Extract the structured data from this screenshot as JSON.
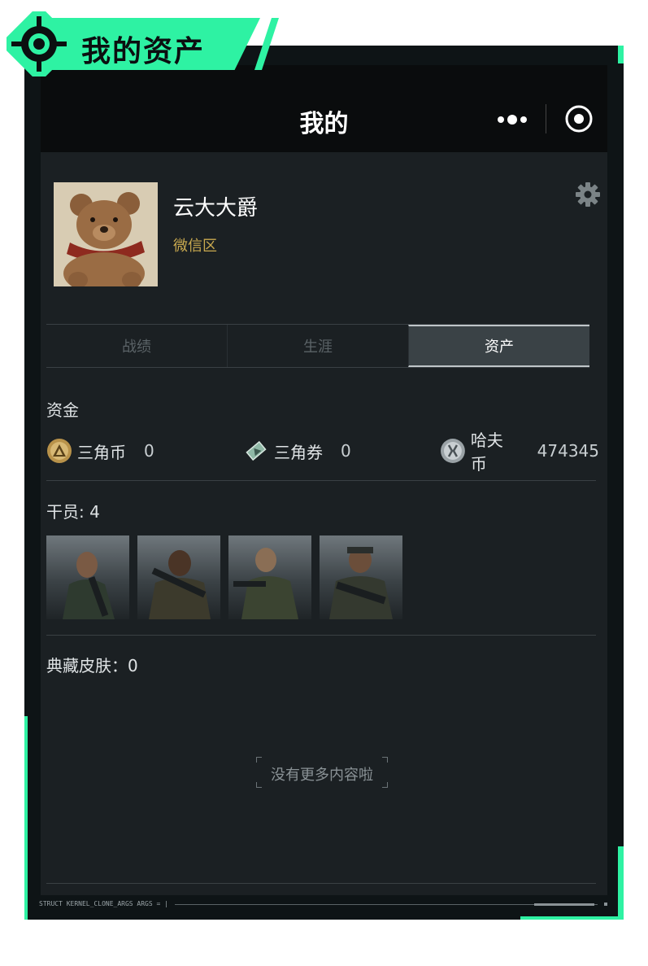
{
  "banner": {
    "title": "我的资产"
  },
  "navbar": {
    "title": "我的"
  },
  "profile": {
    "username": "云大大爵",
    "zone": "微信区"
  },
  "tabs": [
    {
      "label": "战绩",
      "active": false
    },
    {
      "label": "生涯",
      "active": false
    },
    {
      "label": "资产",
      "active": true
    }
  ],
  "funds": {
    "title": "资金",
    "currencies": [
      {
        "name": "三角币",
        "value": "0",
        "icon": "triangle-coin-icon"
      },
      {
        "name": "三角券",
        "value": "0",
        "icon": "triangle-ticket-icon"
      },
      {
        "name": "哈夫币",
        "value": "474345",
        "icon": "havoc-coin-icon"
      }
    ]
  },
  "operators": {
    "title": "干员: 4",
    "items": [
      "operator-1",
      "operator-2",
      "operator-3",
      "operator-4"
    ]
  },
  "skins": {
    "title": "典藏皮肤：0"
  },
  "empty": {
    "text": "没有更多内容啦"
  },
  "footer": {
    "code": "STRUCT KERNEL_CLONE_ARGS ARGS = |"
  },
  "colors": {
    "accent": "#2ef2a3",
    "gold": "#c9a94f",
    "background": "#1b2023"
  }
}
